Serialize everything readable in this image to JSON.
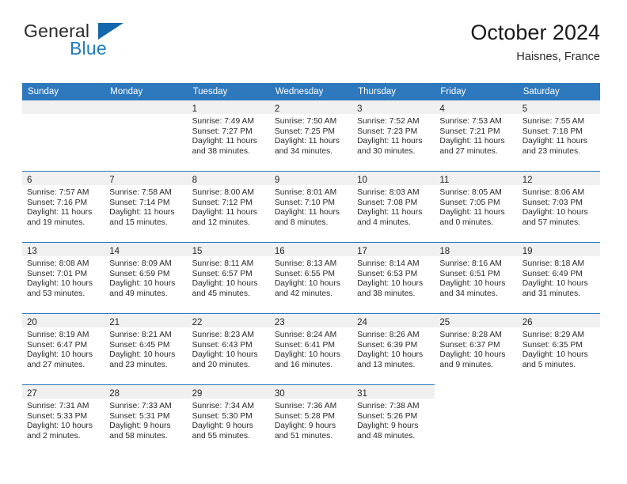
{
  "brand": {
    "name_top": "General",
    "name_bottom": "Blue",
    "triangle_icon": "blue-triangle-logo-mark",
    "color_top": "#2b2b2b",
    "color_bottom": "#1f7bc1",
    "color_triangle": "#1567ad"
  },
  "header": {
    "title": "October 2024",
    "subtitle": "Haisnes, France"
  },
  "theme": {
    "header_row_bg": "#2e78bd",
    "header_row_text": "#ffffff",
    "daynum_band_bg": "#f0f0f0",
    "row_top_border": "#2e78bd",
    "body_text": "#2a2a2a"
  },
  "calendar": {
    "weekdays": [
      "Sunday",
      "Monday",
      "Tuesday",
      "Wednesday",
      "Thursday",
      "Friday",
      "Saturday"
    ],
    "weeks": [
      [
        {
          "day": "",
          "lines": [],
          "state": "blank-band"
        },
        {
          "day": "",
          "lines": [],
          "state": "blank-band"
        },
        {
          "day": "1",
          "lines": [
            "Sunrise: 7:49 AM",
            "Sunset: 7:27 PM",
            "Daylight: 11 hours",
            "and 38 minutes."
          ],
          "state": "filled"
        },
        {
          "day": "2",
          "lines": [
            "Sunrise: 7:50 AM",
            "Sunset: 7:25 PM",
            "Daylight: 11 hours",
            "and 34 minutes."
          ],
          "state": "filled"
        },
        {
          "day": "3",
          "lines": [
            "Sunrise: 7:52 AM",
            "Sunset: 7:23 PM",
            "Daylight: 11 hours",
            "and 30 minutes."
          ],
          "state": "filled"
        },
        {
          "day": "4",
          "lines": [
            "Sunrise: 7:53 AM",
            "Sunset: 7:21 PM",
            "Daylight: 11 hours",
            "and 27 minutes."
          ],
          "state": "filled"
        },
        {
          "day": "5",
          "lines": [
            "Sunrise: 7:55 AM",
            "Sunset: 7:18 PM",
            "Daylight: 11 hours",
            "and 23 minutes."
          ],
          "state": "filled"
        }
      ],
      [
        {
          "day": "6",
          "lines": [
            "Sunrise: 7:57 AM",
            "Sunset: 7:16 PM",
            "Daylight: 11 hours",
            "and 19 minutes."
          ],
          "state": "filled"
        },
        {
          "day": "7",
          "lines": [
            "Sunrise: 7:58 AM",
            "Sunset: 7:14 PM",
            "Daylight: 11 hours",
            "and 15 minutes."
          ],
          "state": "filled"
        },
        {
          "day": "8",
          "lines": [
            "Sunrise: 8:00 AM",
            "Sunset: 7:12 PM",
            "Daylight: 11 hours",
            "and 12 minutes."
          ],
          "state": "filled"
        },
        {
          "day": "9",
          "lines": [
            "Sunrise: 8:01 AM",
            "Sunset: 7:10 PM",
            "Daylight: 11 hours",
            "and 8 minutes."
          ],
          "state": "filled"
        },
        {
          "day": "10",
          "lines": [
            "Sunrise: 8:03 AM",
            "Sunset: 7:08 PM",
            "Daylight: 11 hours",
            "and 4 minutes."
          ],
          "state": "filled"
        },
        {
          "day": "11",
          "lines": [
            "Sunrise: 8:05 AM",
            "Sunset: 7:05 PM",
            "Daylight: 11 hours",
            "and 0 minutes."
          ],
          "state": "filled"
        },
        {
          "day": "12",
          "lines": [
            "Sunrise: 8:06 AM",
            "Sunset: 7:03 PM",
            "Daylight: 10 hours",
            "and 57 minutes."
          ],
          "state": "filled"
        }
      ],
      [
        {
          "day": "13",
          "lines": [
            "Sunrise: 8:08 AM",
            "Sunset: 7:01 PM",
            "Daylight: 10 hours",
            "and 53 minutes."
          ],
          "state": "filled"
        },
        {
          "day": "14",
          "lines": [
            "Sunrise: 8:09 AM",
            "Sunset: 6:59 PM",
            "Daylight: 10 hours",
            "and 49 minutes."
          ],
          "state": "filled"
        },
        {
          "day": "15",
          "lines": [
            "Sunrise: 8:11 AM",
            "Sunset: 6:57 PM",
            "Daylight: 10 hours",
            "and 45 minutes."
          ],
          "state": "filled"
        },
        {
          "day": "16",
          "lines": [
            "Sunrise: 8:13 AM",
            "Sunset: 6:55 PM",
            "Daylight: 10 hours",
            "and 42 minutes."
          ],
          "state": "filled"
        },
        {
          "day": "17",
          "lines": [
            "Sunrise: 8:14 AM",
            "Sunset: 6:53 PM",
            "Daylight: 10 hours",
            "and 38 minutes."
          ],
          "state": "filled"
        },
        {
          "day": "18",
          "lines": [
            "Sunrise: 8:16 AM",
            "Sunset: 6:51 PM",
            "Daylight: 10 hours",
            "and 34 minutes."
          ],
          "state": "filled"
        },
        {
          "day": "19",
          "lines": [
            "Sunrise: 8:18 AM",
            "Sunset: 6:49 PM",
            "Daylight: 10 hours",
            "and 31 minutes."
          ],
          "state": "filled"
        }
      ],
      [
        {
          "day": "20",
          "lines": [
            "Sunrise: 8:19 AM",
            "Sunset: 6:47 PM",
            "Daylight: 10 hours",
            "and 27 minutes."
          ],
          "state": "filled"
        },
        {
          "day": "21",
          "lines": [
            "Sunrise: 8:21 AM",
            "Sunset: 6:45 PM",
            "Daylight: 10 hours",
            "and 23 minutes."
          ],
          "state": "filled"
        },
        {
          "day": "22",
          "lines": [
            "Sunrise: 8:23 AM",
            "Sunset: 6:43 PM",
            "Daylight: 10 hours",
            "and 20 minutes."
          ],
          "state": "filled"
        },
        {
          "day": "23",
          "lines": [
            "Sunrise: 8:24 AM",
            "Sunset: 6:41 PM",
            "Daylight: 10 hours",
            "and 16 minutes."
          ],
          "state": "filled"
        },
        {
          "day": "24",
          "lines": [
            "Sunrise: 8:26 AM",
            "Sunset: 6:39 PM",
            "Daylight: 10 hours",
            "and 13 minutes."
          ],
          "state": "filled"
        },
        {
          "day": "25",
          "lines": [
            "Sunrise: 8:28 AM",
            "Sunset: 6:37 PM",
            "Daylight: 10 hours",
            "and 9 minutes."
          ],
          "state": "filled"
        },
        {
          "day": "26",
          "lines": [
            "Sunrise: 8:29 AM",
            "Sunset: 6:35 PM",
            "Daylight: 10 hours",
            "and 5 minutes."
          ],
          "state": "filled"
        }
      ],
      [
        {
          "day": "27",
          "lines": [
            "Sunrise: 7:31 AM",
            "Sunset: 5:33 PM",
            "Daylight: 10 hours",
            "and 2 minutes."
          ],
          "state": "filled"
        },
        {
          "day": "28",
          "lines": [
            "Sunrise: 7:33 AM",
            "Sunset: 5:31 PM",
            "Daylight: 9 hours",
            "and 58 minutes."
          ],
          "state": "filled"
        },
        {
          "day": "29",
          "lines": [
            "Sunrise: 7:34 AM",
            "Sunset: 5:30 PM",
            "Daylight: 9 hours",
            "and 55 minutes."
          ],
          "state": "filled"
        },
        {
          "day": "30",
          "lines": [
            "Sunrise: 7:36 AM",
            "Sunset: 5:28 PM",
            "Daylight: 9 hours",
            "and 51 minutes."
          ],
          "state": "filled"
        },
        {
          "day": "31",
          "lines": [
            "Sunrise: 7:38 AM",
            "Sunset: 5:26 PM",
            "Daylight: 9 hours",
            "and 48 minutes."
          ],
          "state": "filled"
        },
        {
          "day": "",
          "lines": [],
          "state": "empty"
        },
        {
          "day": "",
          "lines": [],
          "state": "empty"
        }
      ]
    ]
  }
}
